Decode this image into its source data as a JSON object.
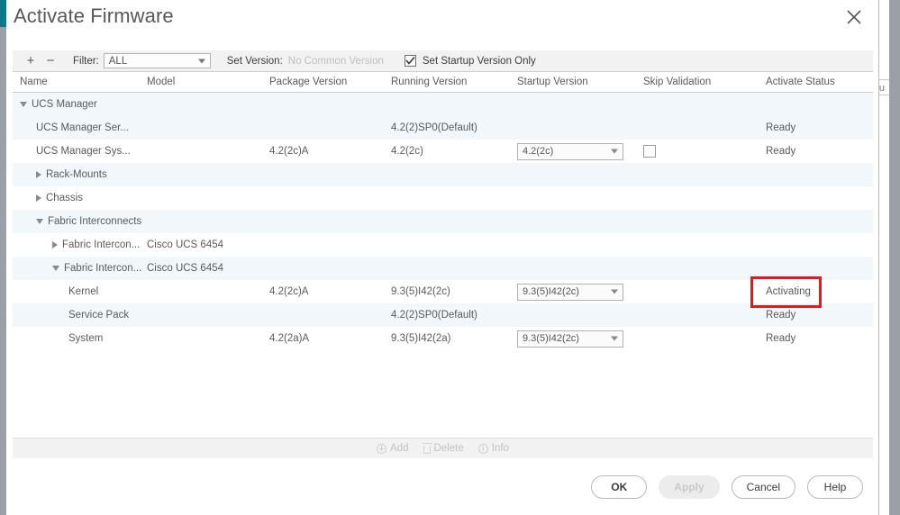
{
  "background": {
    "right_fragment_text": "tu"
  },
  "dialog": {
    "title": "Activate Firmware",
    "close_icon": "close-icon"
  },
  "toolbar": {
    "add_icon": "plus-icon",
    "remove_icon": "minus-icon",
    "filter_label": "Filter:",
    "filter_value": "ALL",
    "set_version_label": "Set Version:",
    "set_version_value": "No Common Version",
    "startup_only_label": "Set Startup Version Only",
    "startup_only_checked": true
  },
  "table": {
    "columns": [
      "Name",
      "Model",
      "Package Version",
      "Running Version",
      "Startup Version",
      "Skip Validation",
      "Activate Status"
    ],
    "rows": [
      {
        "name": "UCS Manager",
        "indent": 0,
        "twisty": "open",
        "model": "",
        "package_version": "",
        "running_version": "",
        "startup_version": null,
        "skip_validation": false,
        "status": "",
        "shade": "group"
      },
      {
        "name": "UCS Manager Ser...",
        "indent": 1,
        "twisty": "none",
        "model": "",
        "package_version": "",
        "running_version": "4.2(2)SP0(Default)",
        "startup_version": null,
        "skip_validation": false,
        "status": "Ready",
        "shade": "alt"
      },
      {
        "name": "UCS Manager Sys...",
        "indent": 1,
        "twisty": "none",
        "model": "",
        "package_version": "4.2(2c)A",
        "running_version": "4.2(2c)",
        "startup_version": "4.2(2c)",
        "skip_validation": true,
        "status": "Ready",
        "shade": "plain"
      },
      {
        "name": "Rack-Mounts",
        "indent": 1,
        "twisty": "closed",
        "model": "",
        "package_version": "",
        "running_version": "",
        "startup_version": null,
        "skip_validation": false,
        "status": "",
        "shade": "alt"
      },
      {
        "name": "Chassis",
        "indent": 1,
        "twisty": "closed",
        "model": "",
        "package_version": "",
        "running_version": "",
        "startup_version": null,
        "skip_validation": false,
        "status": "",
        "shade": "plain"
      },
      {
        "name": "Fabric Interconnects",
        "indent": 1,
        "twisty": "open",
        "model": "",
        "package_version": "",
        "running_version": "",
        "startup_version": null,
        "skip_validation": false,
        "status": "",
        "shade": "alt"
      },
      {
        "name": "Fabric Intercon...",
        "indent": 2,
        "twisty": "closed",
        "model": "Cisco UCS 6454",
        "package_version": "",
        "running_version": "",
        "startup_version": null,
        "skip_validation": false,
        "status": "",
        "shade": "plain"
      },
      {
        "name": "Fabric Intercon...",
        "indent": 2,
        "twisty": "open",
        "model": "Cisco UCS 6454",
        "package_version": "",
        "running_version": "",
        "startup_version": null,
        "skip_validation": false,
        "status": "",
        "shade": "alt"
      },
      {
        "name": "Kernel",
        "indent": 3,
        "twisty": "none",
        "model": "",
        "package_version": "4.2(2c)A",
        "running_version": "9.3(5)I42(2c)",
        "startup_version": "9.3(5)I42(2c)",
        "skip_validation": false,
        "status": "Activating",
        "shade": "plain",
        "highlight": true
      },
      {
        "name": "Service Pack",
        "indent": 3,
        "twisty": "none",
        "model": "",
        "package_version": "",
        "running_version": "4.2(2)SP0(Default)",
        "startup_version": null,
        "skip_validation": false,
        "status": "Ready",
        "shade": "alt"
      },
      {
        "name": "System",
        "indent": 3,
        "twisty": "none",
        "model": "",
        "package_version": "4.2(2a)A",
        "running_version": "9.3(5)I42(2a)",
        "startup_version": "9.3(5)I42(2c)",
        "skip_validation": false,
        "status": "Ready",
        "shade": "plain"
      }
    ]
  },
  "table_actions": {
    "add_label": "Add",
    "delete_label": "Delete",
    "info_label": "Info"
  },
  "footer": {
    "ok_label": "OK",
    "apply_label": "Apply",
    "cancel_label": "Cancel",
    "help_label": "Help",
    "apply_disabled": true
  },
  "colors": {
    "accent_teal": "#0d7a8c",
    "highlight_red": "#e01b1b",
    "row_alt": "#f1f7fb",
    "toolbar_gray": "#f2f2f2"
  }
}
